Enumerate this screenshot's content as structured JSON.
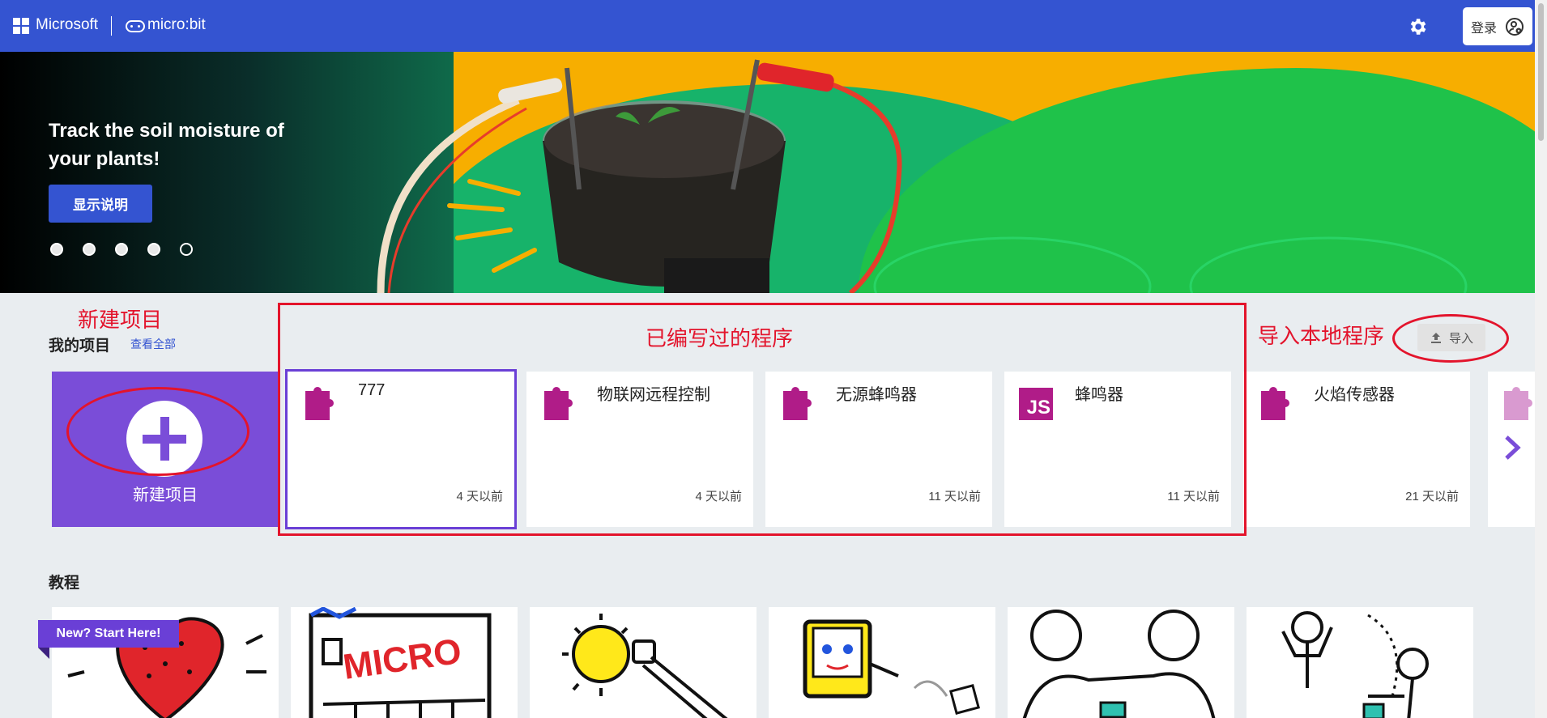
{
  "header": {
    "brand": "Microsoft",
    "product": "micro:bit",
    "settings_icon": "gear-icon",
    "login_label": "登录",
    "login_icon": "account-settings-icon",
    "color": "#3454d1"
  },
  "hero": {
    "title": "Track the soil moisture of your plants!",
    "button_label": "显示说明",
    "dots_count": 5,
    "active_dot": 5
  },
  "annotations": {
    "new_project": "新建项目",
    "written_programs": "已编写过的程序",
    "import_local": "导入本地程序"
  },
  "my_projects": {
    "title": "我的项目",
    "view_all": "查看全部",
    "new_card_label": "新建项目",
    "import_label": "导入",
    "items": [
      {
        "name": "777",
        "time": "4 天以前",
        "icon": "puzzle-icon"
      },
      {
        "name": "物联网远程控制",
        "time": "4 天以前",
        "icon": "puzzle-icon"
      },
      {
        "name": "无源蜂鸣器",
        "time": "11 天以前",
        "icon": "puzzle-icon"
      },
      {
        "name": "蜂鸣器",
        "time": "11 天以前",
        "icon": "js-icon",
        "icon_text": "JS"
      },
      {
        "name": "火焰传感器",
        "time": "21 天以前",
        "icon": "puzzle-icon"
      }
    ]
  },
  "tutorials": {
    "title": "教程",
    "badge": "New? Start Here!",
    "card_images": [
      "heart-drawing",
      "micro-bit-drawing",
      "sun-button-drawing",
      "robot-dice-drawing",
      "kids-playing-drawing",
      "people-waving-drawing"
    ]
  },
  "colors": {
    "accent": "#3454d1",
    "purple": "#7a4dd8",
    "magenta": "#b01c88",
    "annotation_red": "#e3142c"
  }
}
